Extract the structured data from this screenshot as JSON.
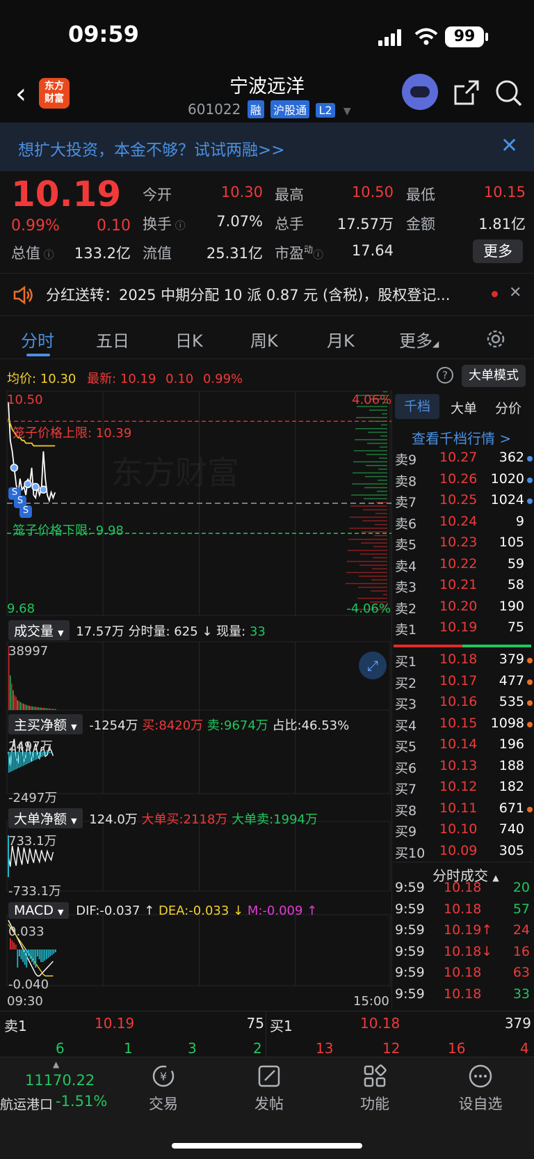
{
  "status": {
    "time": "09:59",
    "battery": "99"
  },
  "header": {
    "logo": [
      "东方",
      "财富"
    ],
    "name": "宁波远洋",
    "code": "601022",
    "tags": [
      "融",
      "沪股通",
      "L2"
    ]
  },
  "banner": {
    "text": "想扩大投资，本金不够？试试两融>>"
  },
  "quote": {
    "price": "10.19",
    "change_pct": "0.99%",
    "change": "0.10",
    "fields": [
      {
        "label": "今开",
        "value": "10.30",
        "color": "red"
      },
      {
        "label": "最高",
        "value": "10.50",
        "color": "red"
      },
      {
        "label": "最低",
        "value": "10.15",
        "color": "red"
      },
      {
        "label": "换手",
        "value": "7.07%",
        "color": "white"
      },
      {
        "label": "总手",
        "value": "17.57万",
        "color": "white"
      },
      {
        "label": "金额",
        "value": "1.81亿",
        "color": "white"
      },
      {
        "label": "总值",
        "value": "133.2亿",
        "color": "white"
      },
      {
        "label": "流值",
        "value": "25.31亿",
        "color": "white"
      },
      {
        "label": "市盈",
        "sup": "动",
        "value": "17.64",
        "color": "white"
      }
    ],
    "more": "更多"
  },
  "notice": {
    "text": "分红送转：2025 中期分配 10 派 0.87 元 (含税)，股权登记..."
  },
  "tabs": [
    "分时",
    "五日",
    "日K",
    "周K",
    "月K",
    "更多"
  ],
  "chart_info": {
    "avg_label": "均价:",
    "avg": "10.30",
    "latest_label": "最新:",
    "latest": "10.19",
    "chg": "0.10",
    "pct": "0.99%",
    "mode_btn": "大单模式",
    "help": "?"
  },
  "chart_data": {
    "type": "line",
    "title": "",
    "ylim": [
      9.68,
      10.5
    ],
    "y_top": "10.50",
    "y_bottom": "9.68",
    "pct_top": "4.06%",
    "pct_bottom": "-4.06%",
    "upper_limit_label": "笼子价格上限: 10.39",
    "lower_limit_label": "笼子价格下限: 9.98",
    "upper_limit": 10.39,
    "lower_limit": 9.98,
    "prev_close": 10.09,
    "x_start": "09:30",
    "x_end": "15:00",
    "series": [
      {
        "values": [
          10.46,
          10.32,
          10.28,
          10.22,
          10.16,
          10.12,
          10.18,
          10.14,
          10.15,
          10.12,
          10.18,
          10.16,
          10.22,
          10.12,
          10.11,
          10.15,
          10.12,
          10.14,
          10.28,
          10.18,
          10.12,
          10.1,
          10.13,
          10.11,
          10.13
        ]
      },
      {
        "values": [
          10.4,
          10.38,
          10.36,
          10.35,
          10.34,
          10.33,
          10.33,
          10.32,
          10.32,
          10.31,
          10.31,
          10.31,
          10.31,
          10.3,
          10.3,
          10.3,
          10.3,
          10.3,
          10.3,
          10.3,
          10.3,
          10.3,
          10.3,
          10.3,
          10.3
        ]
      }
    ],
    "volume": {
      "label": "成交量",
      "info": "17.57万 分时量: 625 ↓ 现量:",
      "now": "33",
      "max": "38997",
      "values": [
        38997,
        21000,
        16000,
        12000,
        9000,
        8000,
        6000,
        5500,
        4800,
        4200,
        3900,
        3500,
        3100,
        2800,
        2600,
        2400,
        2200,
        2100,
        2000,
        1800,
        1700,
        1600,
        1500,
        1400,
        1300,
        1200,
        1100,
        1000,
        900,
        800,
        700,
        650,
        625
      ],
      "colors": [
        "r",
        "g",
        "r",
        "g",
        "r",
        "r",
        "g",
        "r",
        "g",
        "r",
        "g",
        "r",
        "g",
        "r",
        "g",
        "r",
        "g",
        "r",
        "g",
        "r",
        "g",
        "r",
        "g",
        "r",
        "g",
        "r",
        "g",
        "r",
        "g",
        "r",
        "g",
        "r",
        "g"
      ]
    },
    "net_main": {
      "label": "主买净额",
      "value": "-1254万",
      "buy": "买:8420万",
      "sell": "卖:9674万",
      "ratio": "占比:46.53%",
      "top": "2497万",
      "bottom": "-2497万"
    },
    "net_big": {
      "label": "大单净额",
      "value": "124.0万",
      "buy": "大单买:2118万",
      "sell": "大单卖:1994万",
      "top": "733.1万",
      "bottom": "-733.1万"
    },
    "macd": {
      "label": "MACD",
      "dif": "DIF:-0.037 ↑",
      "dea": "DEA:-0.033 ↓",
      "m": "M:-0.009 ↑",
      "top": "0.033",
      "bottom": "-0.040"
    }
  },
  "orderbook": {
    "tabs": [
      "千档",
      "大单",
      "分价"
    ],
    "link": "查看千档行情 >",
    "sells": [
      {
        "label": "卖9",
        "price": "10.27",
        "vol": "362",
        "dot": "blue"
      },
      {
        "label": "卖8",
        "price": "10.26",
        "vol": "1020",
        "dot": "blue"
      },
      {
        "label": "卖7",
        "price": "10.25",
        "vol": "1024",
        "dot": "blue"
      },
      {
        "label": "卖6",
        "price": "10.24",
        "vol": "9",
        "dot": ""
      },
      {
        "label": "卖5",
        "price": "10.23",
        "vol": "105",
        "dot": ""
      },
      {
        "label": "卖4",
        "price": "10.22",
        "vol": "59",
        "dot": ""
      },
      {
        "label": "卖3",
        "price": "10.21",
        "vol": "58",
        "dot": ""
      },
      {
        "label": "卖2",
        "price": "10.20",
        "vol": "190",
        "dot": ""
      },
      {
        "label": "卖1",
        "price": "10.19",
        "vol": "75",
        "dot": ""
      }
    ],
    "buys": [
      {
        "label": "买1",
        "price": "10.18",
        "vol": "379",
        "dot": "orange"
      },
      {
        "label": "买2",
        "price": "10.17",
        "vol": "477",
        "dot": "orange"
      },
      {
        "label": "买3",
        "price": "10.16",
        "vol": "535",
        "dot": "orange"
      },
      {
        "label": "买4",
        "price": "10.15",
        "vol": "1098",
        "dot": "orange"
      },
      {
        "label": "买5",
        "price": "10.14",
        "vol": "196",
        "dot": ""
      },
      {
        "label": "买6",
        "price": "10.13",
        "vol": "188",
        "dot": ""
      },
      {
        "label": "买7",
        "price": "10.12",
        "vol": "182",
        "dot": ""
      },
      {
        "label": "买8",
        "price": "10.11",
        "vol": "671",
        "dot": "orange"
      },
      {
        "label": "买9",
        "price": "10.10",
        "vol": "740",
        "dot": ""
      },
      {
        "label": "买10",
        "price": "10.09",
        "vol": "305",
        "dot": ""
      }
    ]
  },
  "trades": {
    "title": "分时成交",
    "rows": [
      {
        "time": "9:59",
        "price": "10.18",
        "vol": "20",
        "vcolor": "green"
      },
      {
        "time": "9:59",
        "price": "10.18",
        "vol": "57",
        "vcolor": "green"
      },
      {
        "time": "9:59",
        "price": "10.19↑",
        "vol": "24",
        "vcolor": "red"
      },
      {
        "time": "9:59",
        "price": "10.18↓",
        "vol": "16",
        "vcolor": "red"
      },
      {
        "time": "9:59",
        "price": "10.18",
        "vol": "63",
        "vcolor": "red"
      },
      {
        "time": "9:59",
        "price": "10.18",
        "vol": "33",
        "vcolor": "green"
      }
    ]
  },
  "bottom_quote": {
    "sell_label": "卖1",
    "sell_price": "10.19",
    "sell_vol": "75",
    "buy_label": "买1",
    "buy_price": "10.18",
    "buy_vol": "379",
    "sell_counts": [
      "6",
      "1",
      "3",
      "2"
    ],
    "buy_counts": [
      "13",
      "12",
      "16",
      "4"
    ]
  },
  "nav": {
    "index_value": "11170.22",
    "index_name": "航运港口",
    "index_pct": "-1.51%",
    "items": [
      "交易",
      "发帖",
      "功能",
      "设自选"
    ]
  }
}
